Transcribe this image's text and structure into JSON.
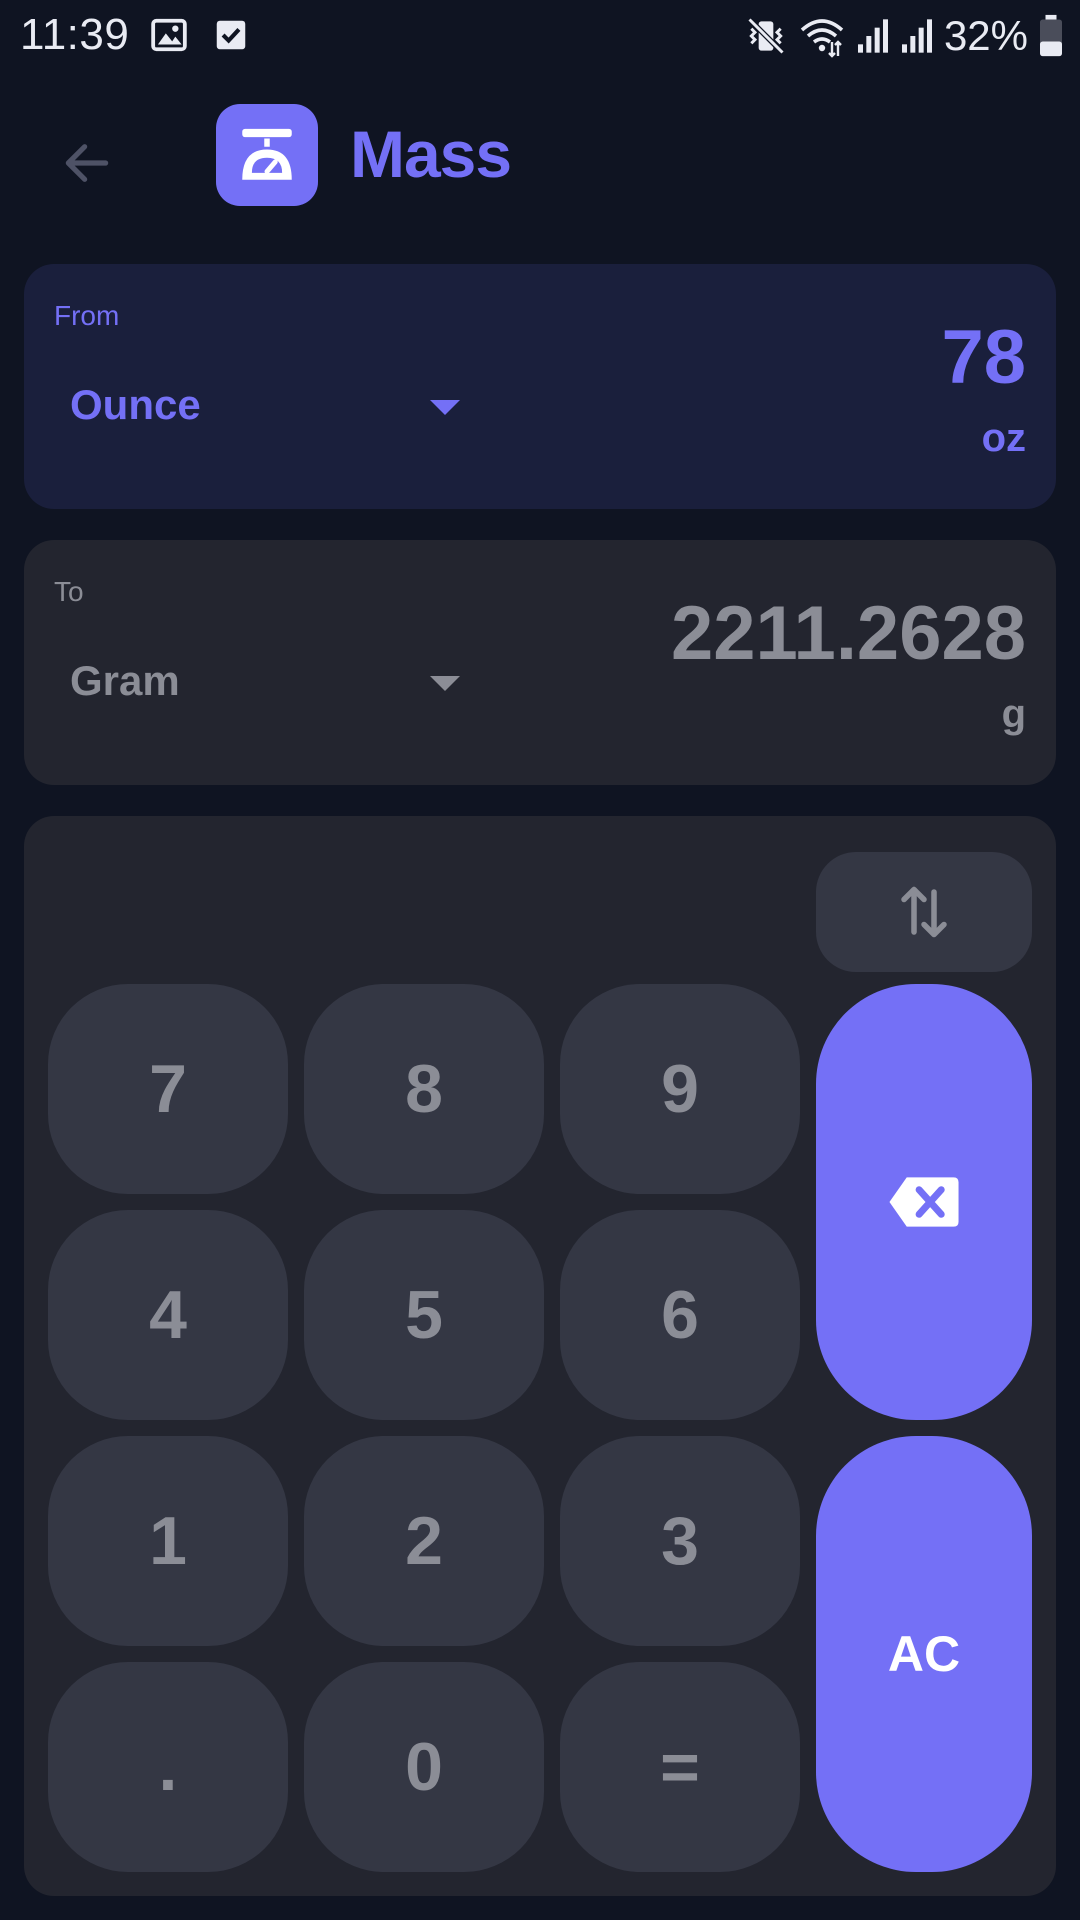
{
  "status_bar": {
    "time": "11:39",
    "battery": "32%",
    "icons": [
      "image-icon",
      "checkbox-icon",
      "vibrate-icon",
      "wifi-icon",
      "signal-icon",
      "signal-icon",
      "battery-icon"
    ]
  },
  "app_bar": {
    "title": "Mass",
    "back_icon": "arrow-left-icon",
    "app_icon": "scale-icon"
  },
  "from": {
    "label": "From",
    "unit": "Ounce",
    "value": "78",
    "symbol": "oz"
  },
  "to": {
    "label": "To",
    "unit": "Gram",
    "value": "2211.2628",
    "symbol": "g"
  },
  "keypad": {
    "keys": [
      "7",
      "8",
      "9",
      "4",
      "5",
      "6",
      "1",
      "2",
      "3",
      ".",
      "0",
      "="
    ],
    "swap_icon": "swap-vertical-icon",
    "backspace_icon": "backspace-icon",
    "clear_label": "AC"
  },
  "colors": {
    "background": "#0f1422",
    "accent": "#7470f6",
    "from_card": "#1a1f3c",
    "card": "#23252f",
    "key": "#343744",
    "muted_text": "#8b8d96"
  }
}
